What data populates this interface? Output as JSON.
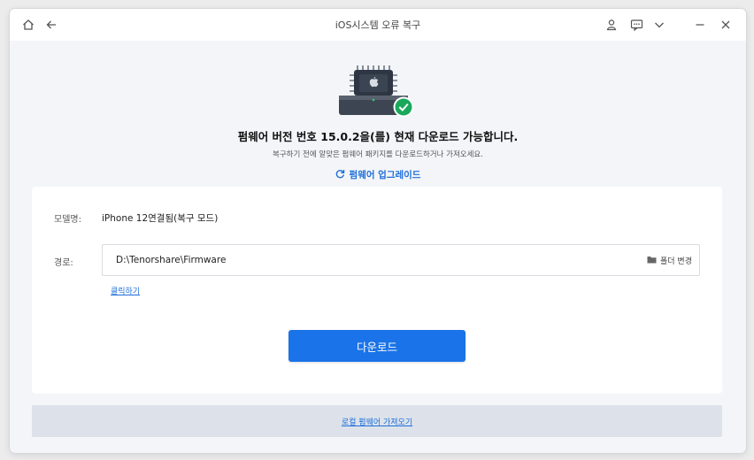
{
  "window": {
    "title": "iOS시스템 오류 복구"
  },
  "titlebar_icons": {
    "home": "home-icon",
    "back": "back-arrow-icon",
    "account": "account-icon",
    "feedback": "message-icon",
    "menu": "chevron-down-icon",
    "minimize": "minimize-icon",
    "close": "close-icon"
  },
  "hero": {
    "icon": "chip-with-checkmark-icon",
    "headline": "펌웨어 버전 번호 15.0.2을(를) 현재 다운로드 가능합니다.",
    "subline": "복구하기 전에 알맞은 펌웨어 패키지를 다운로드하거나 가져오세요.",
    "upgrade_link": "펌웨어 업그레이드"
  },
  "form": {
    "model_label": "모델명:",
    "model_value": "iPhone 12연결됨(복구 모드)",
    "path_label": "경로:",
    "path_value": "D:\\Tenorshare\\Firmware",
    "change_folder": "폴더 변경",
    "open_link": "클릭하기",
    "download_button": "다운로드"
  },
  "footer": {
    "import_link": "로컬 펌웨어 가져오기"
  },
  "colors": {
    "accent": "#1a73e8",
    "success": "#1aa85a",
    "link": "#1f6fd9"
  }
}
